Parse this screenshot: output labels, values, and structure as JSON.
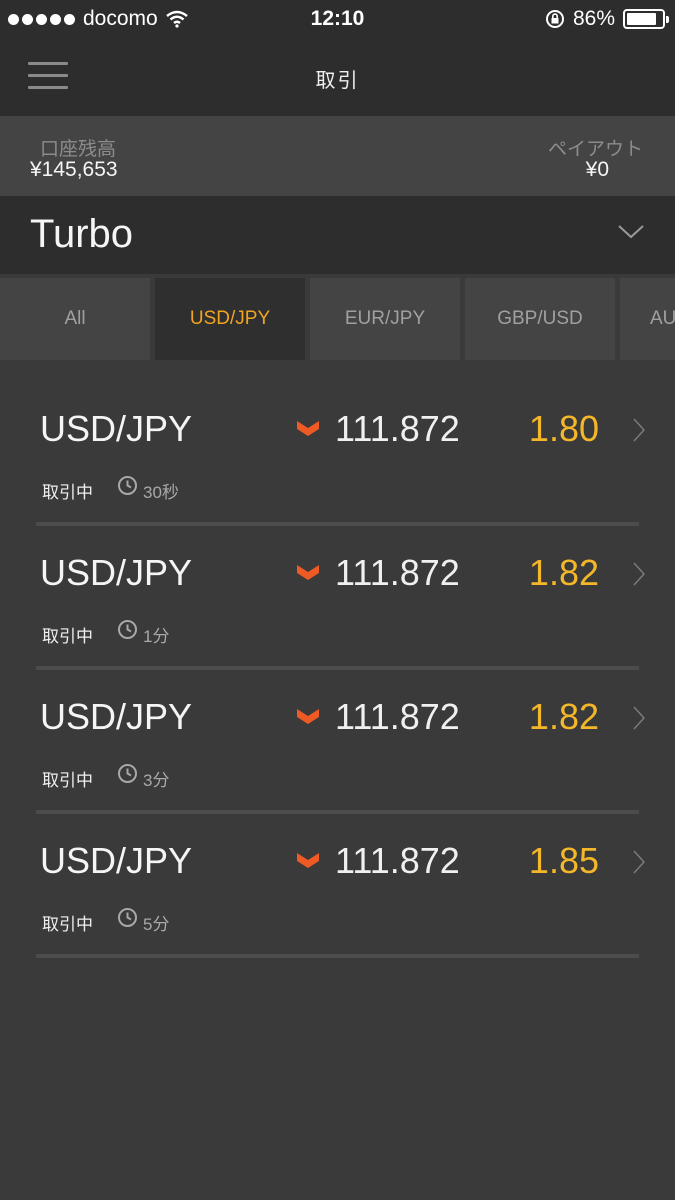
{
  "status_bar": {
    "carrier": "docomo",
    "time": "12:10",
    "battery": "86%",
    "battery_level": 0.86
  },
  "nav": {
    "title": "取引"
  },
  "account": {
    "balance_label": "口座残高",
    "balance_value": "¥145,653",
    "payout_label": "ペイアウト",
    "payout_value": "¥0"
  },
  "product": {
    "name": "Turbo"
  },
  "tabs": [
    {
      "label": "All",
      "active": false
    },
    {
      "label": "USD/JPY",
      "active": true
    },
    {
      "label": "EUR/JPY",
      "active": false
    },
    {
      "label": "GBP/USD",
      "active": false
    },
    {
      "label": "AU",
      "active": false
    }
  ],
  "rows": [
    {
      "pair": "USD/JPY",
      "price": "111.872",
      "rate": "1.80",
      "status": "取引中",
      "duration": "30秒"
    },
    {
      "pair": "USD/JPY",
      "price": "111.872",
      "rate": "1.82",
      "status": "取引中",
      "duration": "1分"
    },
    {
      "pair": "USD/JPY",
      "price": "111.872",
      "rate": "1.82",
      "status": "取引中",
      "duration": "3分"
    },
    {
      "pair": "USD/JPY",
      "price": "111.872",
      "rate": "1.85",
      "status": "取引中",
      "duration": "5分"
    }
  ],
  "colors": {
    "accent": "#f0a420",
    "rate": "#f5b72a",
    "down": "#ee5a24"
  },
  "icons": {
    "menu": "hamburger-icon",
    "dropdown": "chevron-down-icon",
    "trend": "down-arrow-icon",
    "detail": "chevron-right-icon",
    "time": "clock-icon"
  }
}
